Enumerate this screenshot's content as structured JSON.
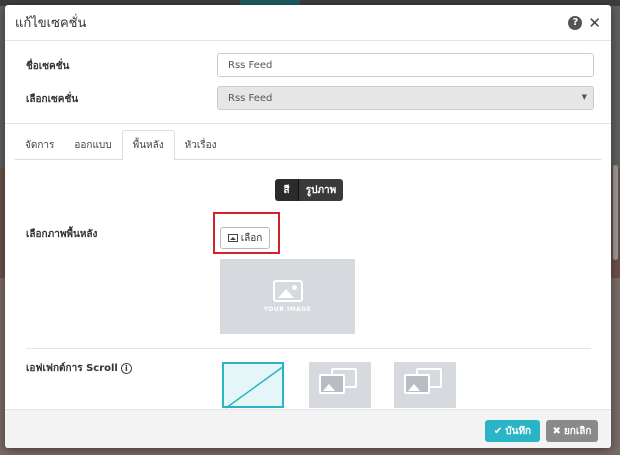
{
  "modal": {
    "title": "แก้ไขเซคชั่น",
    "help_icon": "?",
    "close_icon": "✕"
  },
  "form": {
    "section_name_label": "ชื่อเซคชั่น",
    "section_name_value": "Rss Feed",
    "section_select_label": "เลือกเซคชั่น",
    "section_select_value": "Rss Feed"
  },
  "tabs": [
    {
      "label": "จัดการ",
      "active": false
    },
    {
      "label": "ออกแบบ",
      "active": false
    },
    {
      "label": "พื้นหลัง",
      "active": true
    },
    {
      "label": "หัวเรื่อง",
      "active": false
    }
  ],
  "background": {
    "toggle_color": "สี",
    "toggle_image": "รูปภาพ",
    "image_label": "เลือกภาพพื้นหลัง",
    "choose_button": "เลือก",
    "preview_text": "YOUR IMAGE",
    "scroll_label": "เอฟเฟกต์การ Scroll",
    "info_icon": "i"
  },
  "footer": {
    "save": "บันทึก",
    "cancel": "ยกเลิก",
    "save_icon": "✔",
    "cancel_icon": "✖"
  },
  "colors": {
    "accent": "#29b5c5",
    "highlight": "#d1232a",
    "cancel": "#8a8a8a"
  },
  "icons": [
    "help-icon",
    "close-icon",
    "image-icon",
    "info-icon",
    "check-icon",
    "x-icon"
  ]
}
